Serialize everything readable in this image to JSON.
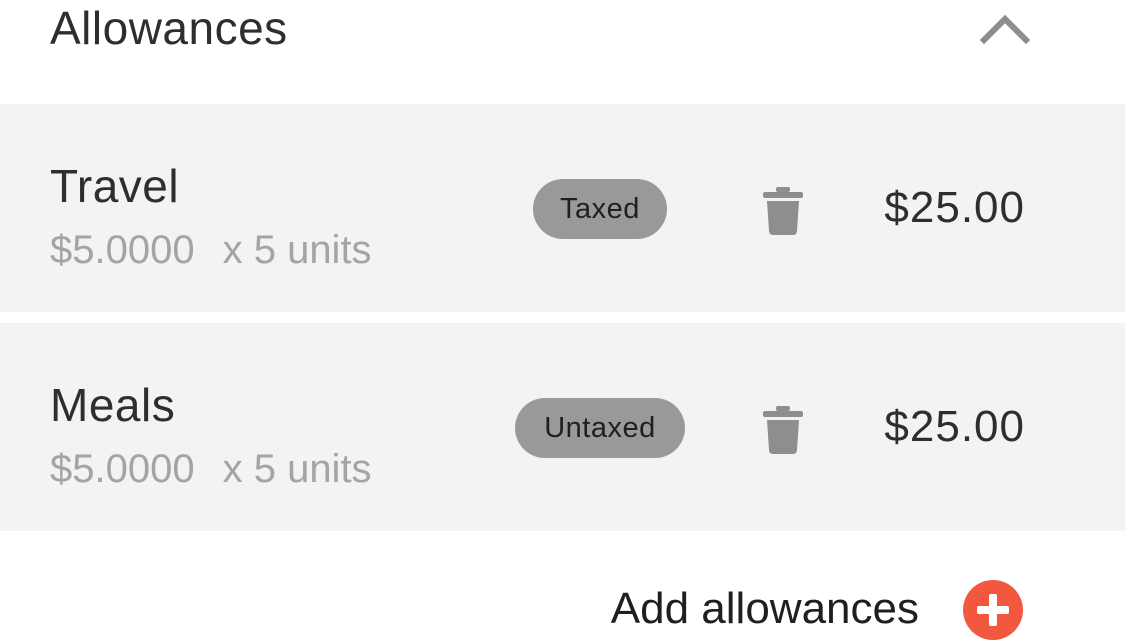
{
  "section": {
    "title": "Allowances",
    "collapse_icon": "chevron-up-icon"
  },
  "allowances": [
    {
      "name": "Travel",
      "rate": "$5.0000",
      "quantity": "x 5 units",
      "tax_status": "Taxed",
      "amount": "$25.00"
    },
    {
      "name": "Meals",
      "rate": "$5.0000",
      "quantity": "x 5 units",
      "tax_status": "Untaxed",
      "amount": "$25.00"
    }
  ],
  "add": {
    "label": "Add allowances",
    "icon": "plus-circle-icon"
  },
  "colors": {
    "row_background": "#f3f3f3",
    "badge_background": "#999999",
    "icon_gray": "#8e8e8e",
    "secondary_text": "#a4a4a4",
    "accent": "#f2583e"
  }
}
